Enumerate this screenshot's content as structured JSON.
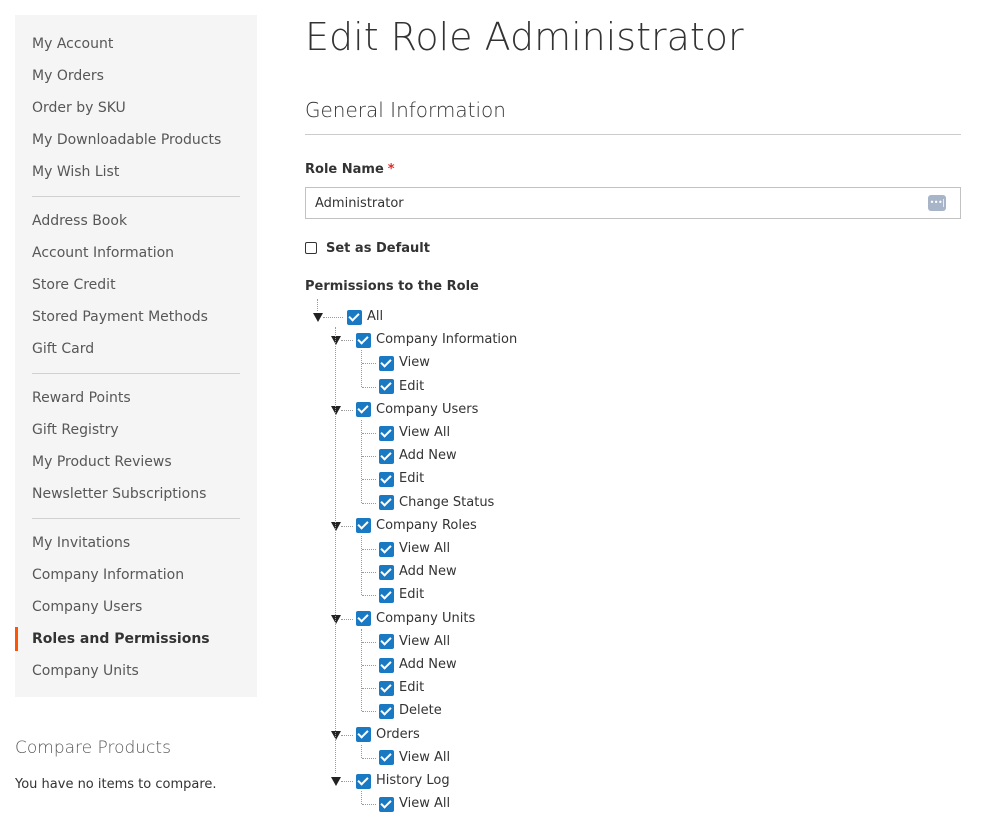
{
  "sidebar": {
    "groups": [
      [
        "My Account",
        "My Orders",
        "Order by SKU",
        "My Downloadable Products",
        "My Wish List"
      ],
      [
        "Address Book",
        "Account Information",
        "Store Credit",
        "Stored Payment Methods",
        "Gift Card"
      ],
      [
        "Reward Points",
        "Gift Registry",
        "My Product Reviews",
        "Newsletter Subscriptions"
      ],
      [
        "My Invitations",
        "Company Information",
        "Company Users",
        "Roles and Permissions",
        "Company Units"
      ]
    ],
    "current": "Roles and Permissions"
  },
  "compare": {
    "title": "Compare Products",
    "empty_text": "You have no items to compare."
  },
  "main": {
    "page_title": "Edit Role Administrator",
    "section_title": "General Information",
    "role_name_label": "Role Name",
    "required_mark": "*",
    "role_name_value": "Administrator",
    "input_icon": "password-manager-icon",
    "set_default_label": "Set as Default",
    "set_default_checked": false,
    "permissions_label": "Permissions to the Role"
  },
  "tree": {
    "label": "All",
    "checked": true,
    "children": [
      {
        "label": "Company Information",
        "checked": true,
        "children": [
          {
            "label": "View",
            "checked": true
          },
          {
            "label": "Edit",
            "checked": true
          }
        ]
      },
      {
        "label": "Company Users",
        "checked": true,
        "children": [
          {
            "label": "View All",
            "checked": true
          },
          {
            "label": "Add New",
            "checked": true
          },
          {
            "label": "Edit",
            "checked": true
          },
          {
            "label": "Change Status",
            "checked": true
          }
        ]
      },
      {
        "label": "Company Roles",
        "checked": true,
        "children": [
          {
            "label": "View All",
            "checked": true
          },
          {
            "label": "Add New",
            "checked": true
          },
          {
            "label": "Edit",
            "checked": true
          }
        ]
      },
      {
        "label": "Company Units",
        "checked": true,
        "children": [
          {
            "label": "View All",
            "checked": true
          },
          {
            "label": "Add New",
            "checked": true
          },
          {
            "label": "Edit",
            "checked": true
          },
          {
            "label": "Delete",
            "checked": true
          }
        ]
      },
      {
        "label": "Orders",
        "checked": true,
        "children": [
          {
            "label": "View All",
            "checked": true
          }
        ]
      },
      {
        "label": "History Log",
        "checked": true,
        "children": [
          {
            "label": "View All",
            "checked": true
          }
        ]
      }
    ]
  },
  "colors": {
    "accent_current": "#ff5501",
    "checkbox": "#1979c3",
    "required": "#e02b27"
  }
}
